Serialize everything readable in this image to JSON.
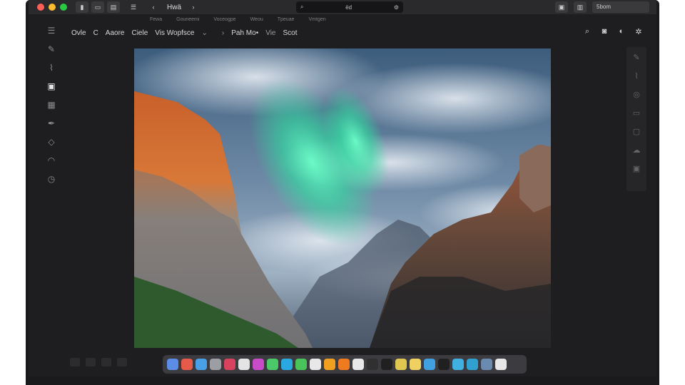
{
  "window": {
    "traffic": [
      "#ff5f57",
      "#febc2e",
      "#28c840"
    ],
    "toolbar_buttons": [
      "▮",
      "▭",
      "▤"
    ],
    "title": "Hwä",
    "search_text": "ëd"
  },
  "top_right": {
    "field": "5bom"
  },
  "menu": [
    "Fewa",
    "Gouneemi",
    "Voceogpe",
    "Weou",
    "Tpeuae",
    "Vmtgen"
  ],
  "toolbar": {
    "items": [
      {
        "label": "Ovle",
        "muted": false
      },
      {
        "label": "C",
        "muted": false
      },
      {
        "label": "Aaore",
        "muted": false
      },
      {
        "label": "Ciele",
        "muted": false
      },
      {
        "label": "Vis Wopfsce",
        "muted": false
      },
      {
        "label": "Pah Mo•",
        "muted": false
      },
      {
        "label": "Vie",
        "muted": true
      },
      {
        "label": "Scot",
        "muted": false
      }
    ]
  },
  "right_toolbar": [
    "search-icon",
    "camera-icon",
    "share-icon",
    "settings-icon"
  ],
  "left_tools": [
    "menu-icon",
    "pencil-icon",
    "brush-icon",
    "crop-icon",
    "layers-icon",
    "pen-icon",
    "eraser-icon",
    "lasso-icon",
    "history-icon"
  ],
  "right_panel": [
    "pencil-icon",
    "brush-icon",
    "circle-icon",
    "square-icon",
    "square-icon",
    "cloud-icon",
    "square-icon"
  ],
  "dock_colors": [
    "#5b8ce6",
    "#e65a4a",
    "#4aa0e6",
    "#9b9ea3",
    "#d9425e",
    "#e4e4e4",
    "#c84cc8",
    "#4ac86a",
    "#2aa8e0",
    "#49c45a",
    "#e8e8e8",
    "#f0a020",
    "#f07a20",
    "#e8e8e8",
    "#303030",
    "#202020",
    "#e0c850",
    "#f0d060",
    "#40a0e0",
    "#202020",
    "#40b0e0",
    "#30a0d0",
    "#6a8ab0",
    "#e8e8e8"
  ]
}
